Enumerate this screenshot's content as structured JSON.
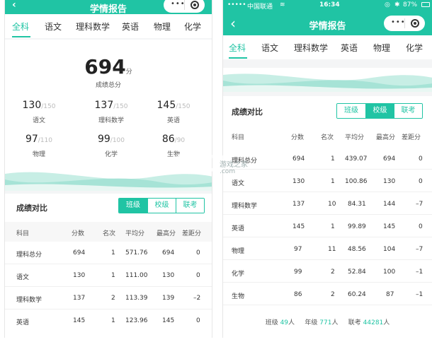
{
  "left": {
    "header": {
      "title": "学情报告",
      "back": "‹"
    },
    "tabs": [
      "全科",
      "语文",
      "理科数学",
      "英语",
      "物理",
      "化学"
    ],
    "summary": {
      "total": "694",
      "total_unit": "分",
      "total_label": "成绩总分",
      "subjects": [
        {
          "score": "130",
          "full": "/150",
          "name": "语文"
        },
        {
          "score": "137",
          "full": "/150",
          "name": "理科数学"
        },
        {
          "score": "145",
          "full": "/150",
          "name": "英语"
        },
        {
          "score": "97",
          "full": "/110",
          "name": "物理"
        },
        {
          "score": "99",
          "full": "/100",
          "name": "化学"
        },
        {
          "score": "86",
          "full": "/90",
          "name": "生物"
        }
      ]
    },
    "compare": {
      "title": "成绩对比",
      "options": [
        "班级",
        "校级",
        "联考"
      ],
      "selected": "班级",
      "columns": [
        "科目",
        "分数",
        "名次",
        "平均分",
        "最高分",
        "差距分"
      ],
      "rows": [
        [
          "理科总分",
          "694",
          "1",
          "571.76",
          "694",
          "0"
        ],
        [
          "语文",
          "130",
          "1",
          "111.00",
          "130",
          "0"
        ],
        [
          "理科数学",
          "137",
          "2",
          "113.39",
          "139",
          "–2"
        ],
        [
          "英语",
          "145",
          "1",
          "123.96",
          "145",
          "0"
        ]
      ]
    }
  },
  "right": {
    "status": {
      "carrier": "中国联通",
      "time": "16:34",
      "battery": "87%"
    },
    "header": {
      "title": "学情报告",
      "back": "‹"
    },
    "tabs": [
      "全科",
      "语文",
      "理科数学",
      "英语",
      "物理",
      "化学"
    ],
    "compare": {
      "title": "成绩对比",
      "options": [
        "班级",
        "校级",
        "联考"
      ],
      "selected": "校级",
      "columns": [
        "科目",
        "分数",
        "名次",
        "平均分",
        "最高分",
        "差距分"
      ],
      "rows": [
        [
          "理科总分",
          "694",
          "1",
          "439.07",
          "694",
          "0"
        ],
        [
          "语文",
          "130",
          "1",
          "100.86",
          "130",
          "0"
        ],
        [
          "理科数学",
          "137",
          "10",
          "84.31",
          "144",
          "–7"
        ],
        [
          "英语",
          "145",
          "1",
          "99.89",
          "145",
          "0"
        ],
        [
          "物理",
          "97",
          "11",
          "48.56",
          "104",
          "–7"
        ],
        [
          "化学",
          "99",
          "2",
          "52.84",
          "100",
          "–1"
        ],
        [
          "生物",
          "86",
          "2",
          "60.24",
          "87",
          "–1"
        ]
      ]
    },
    "footer": {
      "class_label": "班级",
      "class_count": "49",
      "class_unit": "人",
      "grade_label": "年级",
      "grade_count": "771",
      "grade_unit": "人",
      "joint_label": "联考",
      "joint_count": "44281",
      "joint_unit": "人"
    }
  },
  "watermark": {
    "logo": "K73",
    "cn": "游戏之家",
    "url": ".com"
  },
  "colors": {
    "accent": "#20c4a4"
  }
}
